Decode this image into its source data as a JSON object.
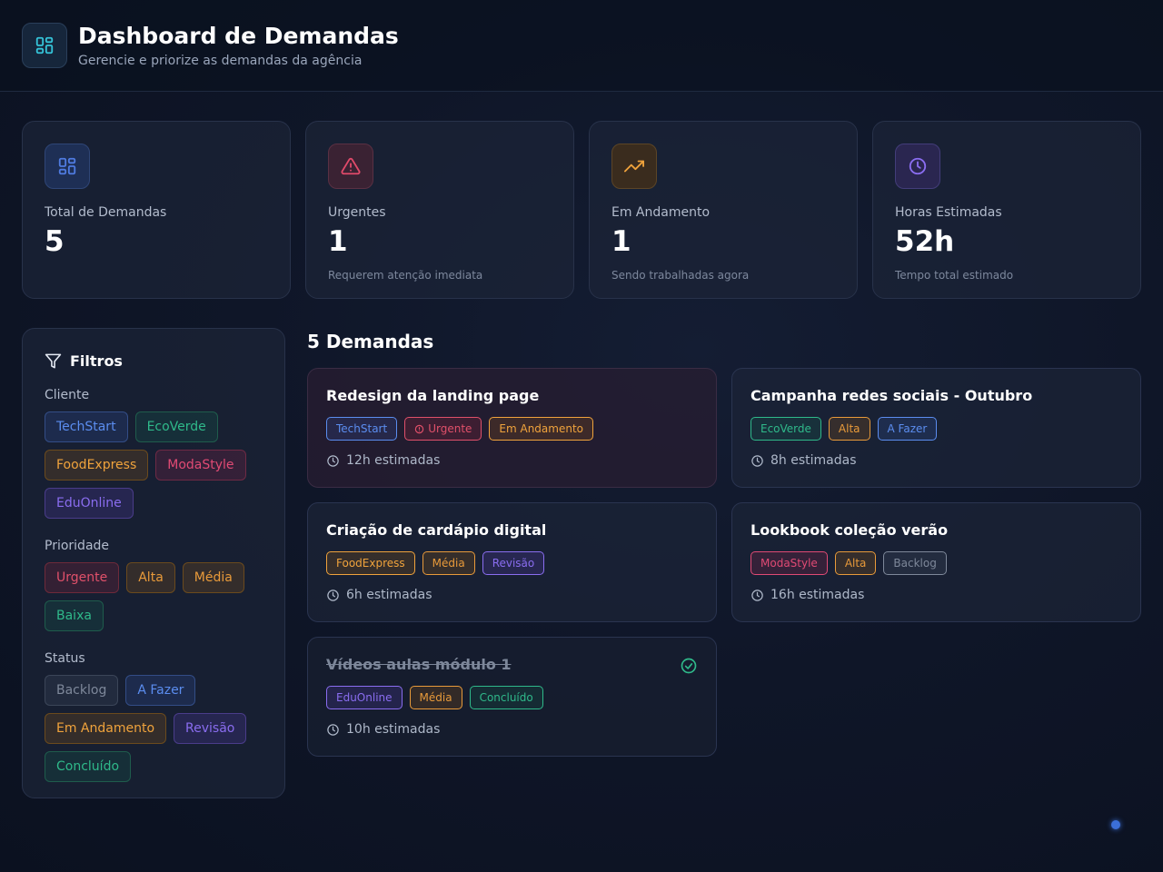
{
  "header": {
    "title": "Dashboard de Demandas",
    "subtitle": "Gerencie e priorize as demandas da agência",
    "logo_icon": "dashboard-grid-icon"
  },
  "stats": [
    {
      "label": "Total de Demandas",
      "value": "5",
      "note": "",
      "icon": "dashboard-grid-icon",
      "color": "#4f7be0"
    },
    {
      "label": "Urgentes",
      "value": "1",
      "note": "Requerem atenção imediata",
      "icon": "alert-triangle-icon",
      "color": "#e04a6a"
    },
    {
      "label": "Em Andamento",
      "value": "1",
      "note": "Sendo trabalhadas agora",
      "icon": "trending-up-icon",
      "color": "#f0a33c"
    },
    {
      "label": "Horas Estimadas",
      "value": "52h",
      "note": "Tempo total estimado",
      "icon": "clock-icon",
      "color": "#8a6df0"
    }
  ],
  "filters": {
    "title": "Filtros",
    "client_label": "Cliente",
    "clients": [
      "TechStart",
      "EcoVerde",
      "FoodExpress",
      "ModaStyle",
      "EduOnline"
    ],
    "priority_label": "Prioridade",
    "priorities": [
      "Urgente",
      "Alta",
      "Média",
      "Baixa"
    ],
    "status_label": "Status",
    "statuses": [
      "Backlog",
      "A Fazer",
      "Em Andamento",
      "Revisão",
      "Concluído"
    ]
  },
  "demands": {
    "title": "5 Demandas",
    "items": [
      {
        "title": "Redesign da landing page",
        "client": "TechStart",
        "priority": "Urgente",
        "status": "Em Andamento",
        "hours": "12h estimadas"
      },
      {
        "title": "Campanha redes sociais - Outubro",
        "client": "EcoVerde",
        "priority": "Alta",
        "status": "A Fazer",
        "hours": "8h estimadas"
      },
      {
        "title": "Criação de cardápio digital",
        "client": "FoodExpress",
        "priority": "Média",
        "status": "Revisão",
        "hours": "6h estimadas"
      },
      {
        "title": "Lookbook coleção verão",
        "client": "ModaStyle",
        "priority": "Alta",
        "status": "Backlog",
        "hours": "16h estimadas"
      },
      {
        "title": "Vídeos aulas módulo 1",
        "client": "EduOnline",
        "priority": "Média",
        "status": "Concluído",
        "hours": "10h estimadas"
      }
    ]
  },
  "colors": {
    "accent": "#5b8def",
    "success": "#2fb98a",
    "warning": "#f0a33c",
    "danger": "#e04a74",
    "purple": "#8a6df0"
  }
}
